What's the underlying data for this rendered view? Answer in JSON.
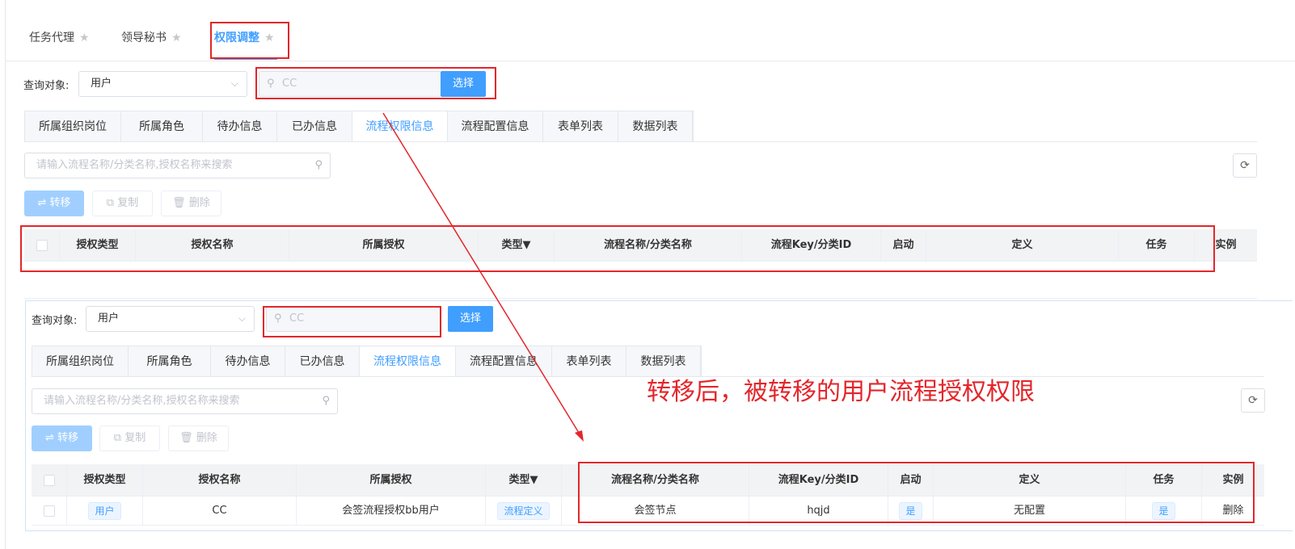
{
  "top_tabs": [
    {
      "label": "任务代理",
      "active": false
    },
    {
      "label": "领导秘书",
      "active": false
    },
    {
      "label": "权限调整",
      "active": true
    }
  ],
  "query": {
    "label": "查询对象:",
    "target_value": "用户",
    "search_value": "CC",
    "select_button": "选择"
  },
  "sub_tabs": [
    "所属组织岗位",
    "所属角色",
    "待办信息",
    "已办信息",
    "流程权限信息",
    "流程配置信息",
    "表单列表",
    "数据列表"
  ],
  "active_sub_tab": "流程权限信息",
  "filter_placeholder": "请输入流程名称/分类名称,授权名称来搜索",
  "actions": {
    "transfer": "转移",
    "copy": "复制",
    "delete": "删除"
  },
  "table_headers": [
    "授权类型",
    "授权名称",
    "所属授权",
    "类型",
    "流程名称/分类名称",
    "流程Key/分类ID",
    "启动",
    "定义",
    "任务",
    "实例"
  ],
  "result_row": {
    "auth_type": "用户",
    "auth_name": "CC",
    "belong": "会签流程授权bb用户",
    "type": "流程定义",
    "flow_name": "会签节点",
    "flow_key": "hqjd",
    "start": "是",
    "define": "无配置",
    "task": "是",
    "instance": "删除"
  },
  "annotation": "转移后，被转移的用户流程授权权限",
  "colors": {
    "accent": "#409eff",
    "annotation_red": "#e3262b"
  }
}
